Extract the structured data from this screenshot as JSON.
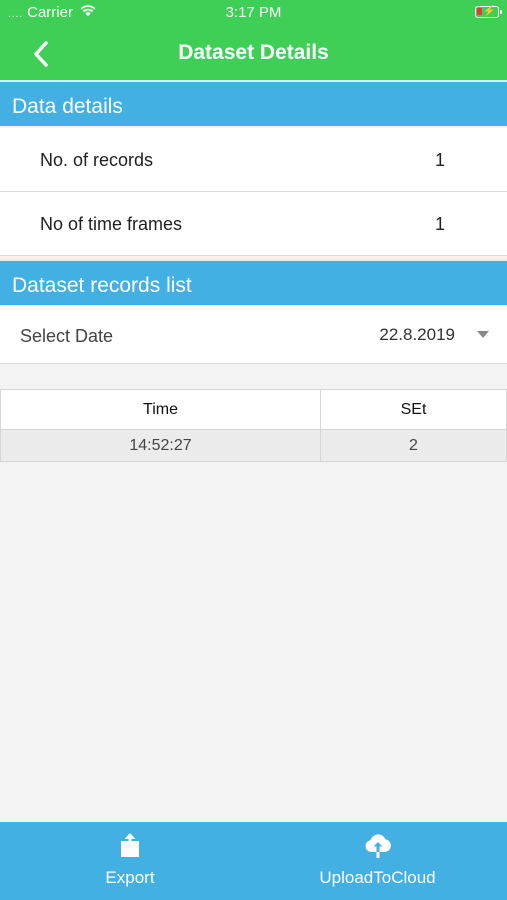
{
  "status_bar": {
    "signal_dots": "....",
    "carrier": "Carrier",
    "time": "3:17 PM"
  },
  "nav": {
    "title": "Dataset Details"
  },
  "data_details": {
    "header": "Data details",
    "rows": [
      {
        "label": "No. of records",
        "value": "1"
      },
      {
        "label": "No of time frames",
        "value": "1"
      }
    ]
  },
  "records": {
    "header": "Dataset records list",
    "select_date_label": "Select Date",
    "selected_date": "22.8.2019",
    "columns": [
      "Time",
      "SEt"
    ],
    "rows": [
      [
        "14:52:27",
        "2"
      ]
    ]
  },
  "bottom_bar": {
    "export_label": "Export",
    "upload_label": "UploadToCloud"
  },
  "colors": {
    "nav_green": "#3fcf57",
    "section_blue": "#43b0e4",
    "background": "#f3f3f3"
  }
}
